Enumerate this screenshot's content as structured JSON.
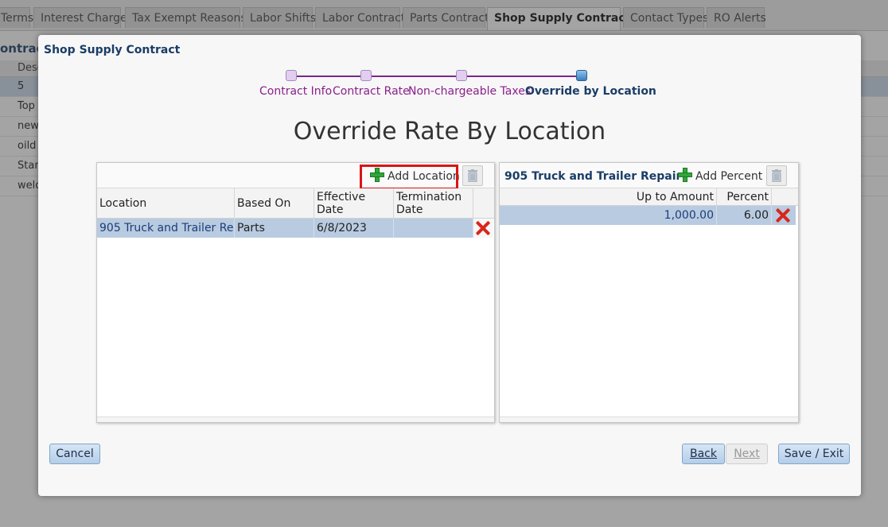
{
  "background": {
    "tabs": [
      "Terms",
      "Interest Charge",
      "Tax Exempt Reasons",
      "Labor Shifts",
      "Labor Contract",
      "Parts Contract",
      "Shop Supply Contract",
      "Contact Types",
      "RO Alerts"
    ],
    "active_tab": "Shop Supply Contract",
    "section_title": "ontract",
    "column_header": "Desc",
    "rows": [
      "5",
      "Top",
      "new",
      "oild",
      "Stan",
      "weld"
    ]
  },
  "modal": {
    "title": "Shop Supply Contract",
    "wizard": {
      "steps": [
        "Contract Info",
        "Contract Rate",
        "Non-chargeable Taxes",
        "Override by Location"
      ],
      "current_step": "Override by Location"
    },
    "heading": "Override Rate By Location",
    "location_panel": {
      "add_label": "Add Location",
      "columns": [
        "Location",
        "Based On",
        "Effective Date",
        "Termination Date"
      ],
      "rows": [
        {
          "location": "905 Truck and Trailer Re...",
          "based_on": "Parts",
          "effective_date": "6/8/2023",
          "termination_date": ""
        }
      ]
    },
    "rate_panel": {
      "title": "905 Truck and Trailer Repair",
      "add_label": "Add Percent",
      "columns": [
        "Up to Amount",
        "Percent"
      ],
      "rows": [
        {
          "up_to_amount": "1,000.00",
          "percent": "6.00"
        }
      ]
    },
    "buttons": {
      "cancel": "Cancel",
      "back": "Back",
      "next": "Next",
      "save_exit": "Save / Exit"
    }
  },
  "colors": {
    "accent_purple": "#8b1f8b",
    "title_blue": "#1a3d66",
    "selected_row": "#b9cbe0",
    "highlight_red": "#d81515"
  }
}
